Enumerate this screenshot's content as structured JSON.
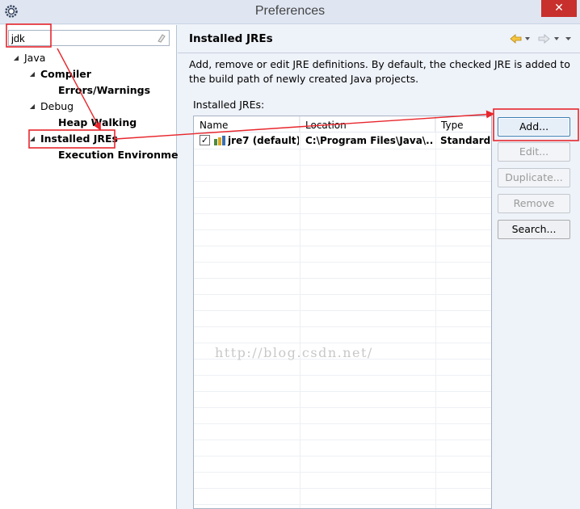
{
  "window": {
    "title": "Preferences",
    "close_label": "✕"
  },
  "filter": {
    "value": "jdk"
  },
  "tree": {
    "java": "Java",
    "compiler": "Compiler",
    "errors_warnings": "Errors/Warnings",
    "debug": "Debug",
    "heap_walking": "Heap Walking",
    "installed_jres": "Installed JREs",
    "execution_environments": "Execution Environmen"
  },
  "page": {
    "title": "Installed JREs",
    "description": "Add, remove or edit JRE definitions. By default, the checked JRE is added to the build path of newly created Java projects.",
    "list_label": "Installed JREs:"
  },
  "table": {
    "columns": [
      "Name",
      "Location",
      "Type"
    ],
    "rows": [
      {
        "checked": true,
        "name": "jre7 (default)",
        "location": "C:\\Program Files\\Java\\...",
        "type": "Standard V"
      }
    ]
  },
  "buttons": {
    "add": "Add...",
    "edit": "Edit...",
    "duplicate": "Duplicate...",
    "remove": "Remove",
    "search": "Search..."
  },
  "watermark": "http://blog.csdn.net/",
  "colors": {
    "annotation": "#e8262c",
    "titlebar": "#dfe6f2",
    "close": "#c7302c"
  }
}
